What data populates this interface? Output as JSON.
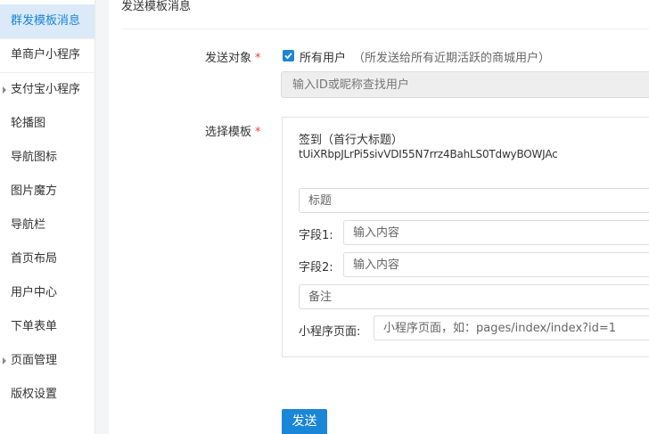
{
  "sidebar": {
    "items": [
      {
        "label": "群发模板消息",
        "active": true
      },
      {
        "label": "单商户小程序"
      },
      {
        "label": "支付宝小程序",
        "has_children": true
      },
      {
        "label": "轮播图"
      },
      {
        "label": "导航图标"
      },
      {
        "label": "图片魔方"
      },
      {
        "label": "导航栏"
      },
      {
        "label": "首页布局"
      },
      {
        "label": "用户中心"
      },
      {
        "label": "下单表单"
      },
      {
        "label": "页面管理",
        "has_children": true
      },
      {
        "label": "版权设置"
      }
    ]
  },
  "page": {
    "title": "发送模板消息"
  },
  "form": {
    "target": {
      "label": "发送对象",
      "checkbox_label": "所有用户",
      "checkbox_checked": true,
      "note": "（所发送给所有近期活跃的商城用户）",
      "search_placeholder": "输入ID或昵称查找用户"
    },
    "template": {
      "label": "选择模板",
      "name": "签到（首行大标题）",
      "id": "tUiXRbpJLrPi5sivVDI55N7rrz4BahLS0TdwyBOWJAc",
      "title_placeholder": "标题",
      "field1_label": "字段1:",
      "field1_placeholder": "输入内容",
      "field2_label": "字段2:",
      "field2_placeholder": "输入内容",
      "remark_placeholder": "备注",
      "page_label": "小程序页面:",
      "page_placeholder": "小程序页面，如：pages/index/index?id=1"
    },
    "submit_label": "发送"
  },
  "colors": {
    "accent": "#1a86d6",
    "active_bg": "#dbe9f8",
    "required": "#e64340"
  }
}
